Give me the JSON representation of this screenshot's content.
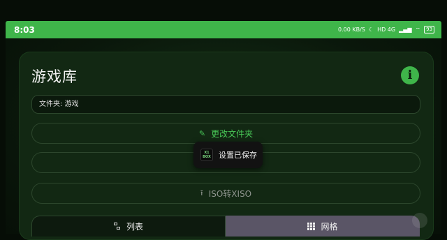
{
  "status_bar": {
    "time": "8:03",
    "network_speed": "0.00 KB/S",
    "signal": "HD 4G",
    "battery": "93"
  },
  "library": {
    "title": "游戏库",
    "folder_label": "文件夹: 游戏",
    "change_folder_label": "更改文件夹",
    "iso_convert_label": "ISO转XISO"
  },
  "tabs": [
    {
      "label": "列表",
      "selected": false
    },
    {
      "label": "网格",
      "selected": true
    }
  ],
  "toast": {
    "message": "设置已保存",
    "logo_line1": "X1",
    "logo_line2": "BOX"
  },
  "colors": {
    "accent": "#3fb54a",
    "card": "#122813",
    "selected_tab": "#5a5566"
  }
}
